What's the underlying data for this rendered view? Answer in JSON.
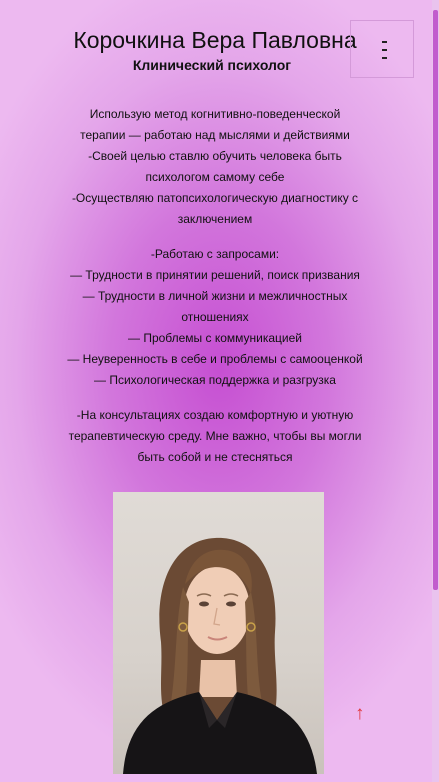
{
  "header": {
    "name": "Корочкина Вера Павловна",
    "role": "Клинический психолог"
  },
  "menu": {
    "icon": "hamburger-menu-icon"
  },
  "about": {
    "lines": [
      "Использую метод когнитивно-поведенческой",
      "терапии — работаю над мыслями и действиями",
      "-Своей целью ставлю обучить человека быть",
      "психологом самому себе",
      "-Осуществляю патопсихологическую диагностику с",
      "заключением"
    ]
  },
  "requests": {
    "lines": [
      "-Работаю с запросами:",
      "— Трудности в принятии решений, поиск призвания",
      "— Трудности в личной жизни и межличностных",
      "отношениях",
      "— Проблемы с коммуникацией",
      "— Неуверенность в себе и проблемы с самооценкой",
      "— Психологическая поддержка и разгрузка"
    ]
  },
  "consult": {
    "lines": [
      "-На консультациях создаю комфортную и уютную",
      "терапевтическую среду. Мне важно, чтобы вы могли",
      "быть собой и не стесняться"
    ]
  },
  "scroll_top": {
    "glyph": "↑",
    "color": "#e0353b"
  },
  "colors": {
    "accent": "#c64fd2",
    "background_light": "#edb9f0"
  }
}
